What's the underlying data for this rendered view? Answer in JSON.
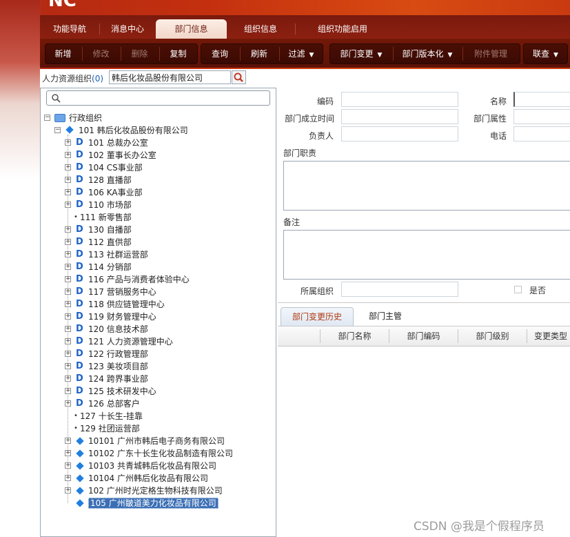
{
  "nav": {
    "tabs": [
      {
        "label": "功能导航"
      },
      {
        "label": "消息中心"
      },
      {
        "label": "部门信息"
      },
      {
        "label": "组织信息"
      },
      {
        "label": "组织功能启用"
      }
    ],
    "active_tab": "部门信息"
  },
  "toolbar": {
    "add": "新增",
    "edit": "修改",
    "delete": "删除",
    "copy": "复制",
    "query": "查询",
    "refresh": "刷新",
    "filter": "过滤",
    "dept_change": "部门变更",
    "dept_version": "部门版本化",
    "attachments": "附件管理",
    "link_query": "联查"
  },
  "org_selector": {
    "label": "人力资源组织",
    "count": "(0)",
    "value": "韩后化妆品股份有限公司"
  },
  "tree": {
    "search_placeholder": "",
    "root": "行政组织",
    "company": "101 韩后化妆品股份有限公司",
    "departments": [
      {
        "label": "101 总裁办公室",
        "type": "dept",
        "expandable": true
      },
      {
        "label": "102 董事长办公室",
        "type": "dept",
        "expandable": true
      },
      {
        "label": "104 CS事业部",
        "type": "dept",
        "expandable": true
      },
      {
        "label": "128 直播部",
        "type": "dept",
        "expandable": true
      },
      {
        "label": "106 KA事业部",
        "type": "dept",
        "expandable": true
      },
      {
        "label": "110 市场部",
        "type": "dept",
        "expandable": true
      },
      {
        "label": "111 新零售部",
        "type": "leaf",
        "expandable": false
      },
      {
        "label": "130 自播部",
        "type": "dept",
        "expandable": true
      },
      {
        "label": "112 直供部",
        "type": "dept",
        "expandable": true
      },
      {
        "label": "113 社群运营部",
        "type": "dept",
        "expandable": true
      },
      {
        "label": "114 分销部",
        "type": "dept",
        "expandable": true
      },
      {
        "label": "116 产品与消费者体验中心",
        "type": "dept",
        "expandable": true
      },
      {
        "label": "117 营销服务中心",
        "type": "dept",
        "expandable": true
      },
      {
        "label": "118 供应链管理中心",
        "type": "dept",
        "expandable": true
      },
      {
        "label": "119 财务管理中心",
        "type": "dept",
        "expandable": true
      },
      {
        "label": "120 信息技术部",
        "type": "dept",
        "expandable": true
      },
      {
        "label": "121 人力资源管理中心",
        "type": "dept",
        "expandable": true
      },
      {
        "label": "122 行政管理部",
        "type": "dept",
        "expandable": true
      },
      {
        "label": "123 美妆项目部",
        "type": "dept",
        "expandable": true
      },
      {
        "label": "124 跨界事业部",
        "type": "dept",
        "expandable": true
      },
      {
        "label": "125 技术研发中心",
        "type": "dept",
        "expandable": true
      },
      {
        "label": "126 总部客户",
        "type": "dept",
        "expandable": true
      },
      {
        "label": "127 十长生-挂靠",
        "type": "leaf",
        "expandable": false
      },
      {
        "label": "129 社团运营部",
        "type": "leaf",
        "expandable": false
      },
      {
        "label": "10101 广州市韩后电子商务有限公司",
        "type": "org",
        "expandable": true
      },
      {
        "label": "10102 广东十长生化妆品制造有限公司",
        "type": "org",
        "expandable": true
      },
      {
        "label": "10103 共青城韩后化妆品有限公司",
        "type": "org",
        "expandable": true
      },
      {
        "label": "10104 广州韩后化妆品有限公司",
        "type": "org",
        "expandable": true
      },
      {
        "label": "102 广州时光定格生物科技有限公司",
        "type": "org",
        "expandable": true
      },
      {
        "label": "105 广州皺道美力化妆品有限公司",
        "type": "org",
        "expandable": false,
        "selected": true
      }
    ]
  },
  "form": {
    "code_label": "编码",
    "name_label": "名称",
    "established_label": "部门成立时间",
    "attribute_label": "部门属性",
    "manager_label": "负责人",
    "phone_label": "电话",
    "duty_label": "部门职责",
    "remark_label": "备注",
    "org_label": "所属组织",
    "yesno_label": "是否"
  },
  "detail_tabs": [
    {
      "label": "部门变更历史"
    },
    {
      "label": "部门主管"
    }
  ],
  "grid": {
    "columns": [
      "部门名称",
      "部门编码",
      "部门级别",
      "变更类型"
    ]
  },
  "watermark": "CSDN @我是个假程序员"
}
